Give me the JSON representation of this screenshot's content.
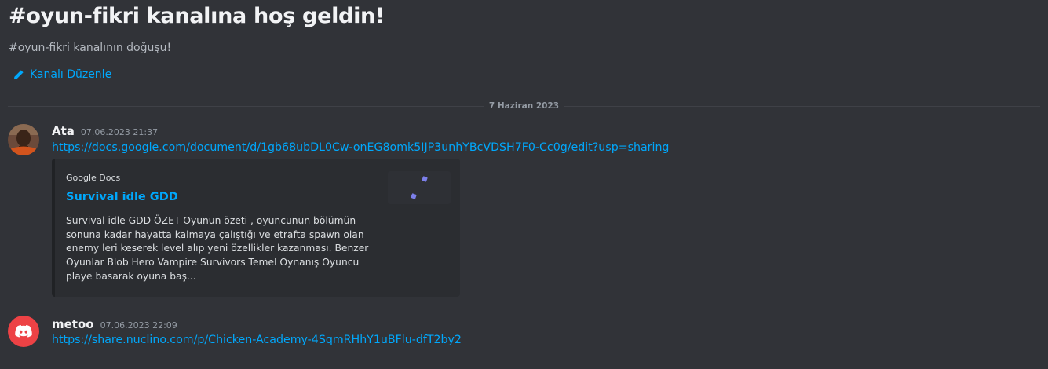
{
  "welcome": {
    "title": "#oyun-fikri kanalına hoş geldin!",
    "subtitle": "#oyun-fikri kanalının doğuşu!",
    "edit_label": "Kanalı Düzenle"
  },
  "date_divider": "7 Haziran 2023",
  "messages": [
    {
      "username": "Ata",
      "timestamp": "07.06.2023 21:37",
      "link": "https://docs.google.com/document/d/1gb68ubDL0Cw-onEG8omk5IJP3unhYBcVDSH7F0-Cc0g/edit?usp=sharing",
      "avatar": "user-photo-avatar",
      "embed": {
        "provider": "Google Docs",
        "title": "Survival idle GDD",
        "description": "Survival idle GDD ÖZET Oyunun özeti , oyuncunun bölümün sonuna kadar hayatta kalmaya çalıştığı ve etrafta spawn olan enemy leri keserek level alıp yeni özellikler kazanması. Benzer Oyunlar Blob Hero Vampire Survivors Temel Oynanış Oyuncu playe basarak oyuna baş..."
      }
    },
    {
      "username": "metoo",
      "timestamp": "07.06.2023 22:09",
      "link": "https://share.nuclino.com/p/Chicken-Academy-4SqmRHhY1uBFlu-dfT2by2",
      "avatar": "discord-logo-icon"
    }
  ],
  "colors": {
    "background": "#313338",
    "link": "#00a8fc",
    "embed_bg": "#2b2d31",
    "discord_red": "#ed4245"
  }
}
